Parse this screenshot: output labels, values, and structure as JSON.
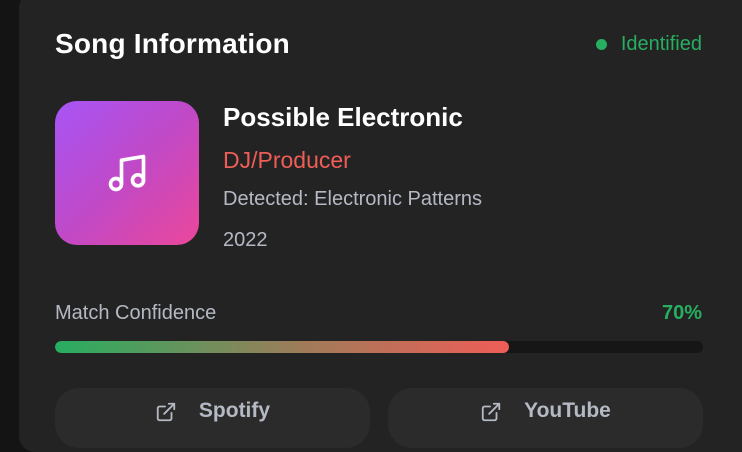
{
  "header": {
    "title": "Song Information",
    "status": "Identified"
  },
  "colors": {
    "status": "#27ae60",
    "artist": "#ef5d57",
    "art_gradient": [
      "#a755f7",
      "#eb479a"
    ]
  },
  "song": {
    "art_icon": "music-note-icon",
    "title": "Possible Electronic",
    "artist": "DJ/Producer",
    "detected": "Detected: Electronic Patterns",
    "year": "2022"
  },
  "confidence": {
    "label": "Match Confidence",
    "value_text": "70%",
    "value": 0.7
  },
  "actions": [
    {
      "label": "Spotify",
      "icon": "external-link-icon"
    },
    {
      "label": "YouTube",
      "icon": "external-link-icon"
    }
  ]
}
